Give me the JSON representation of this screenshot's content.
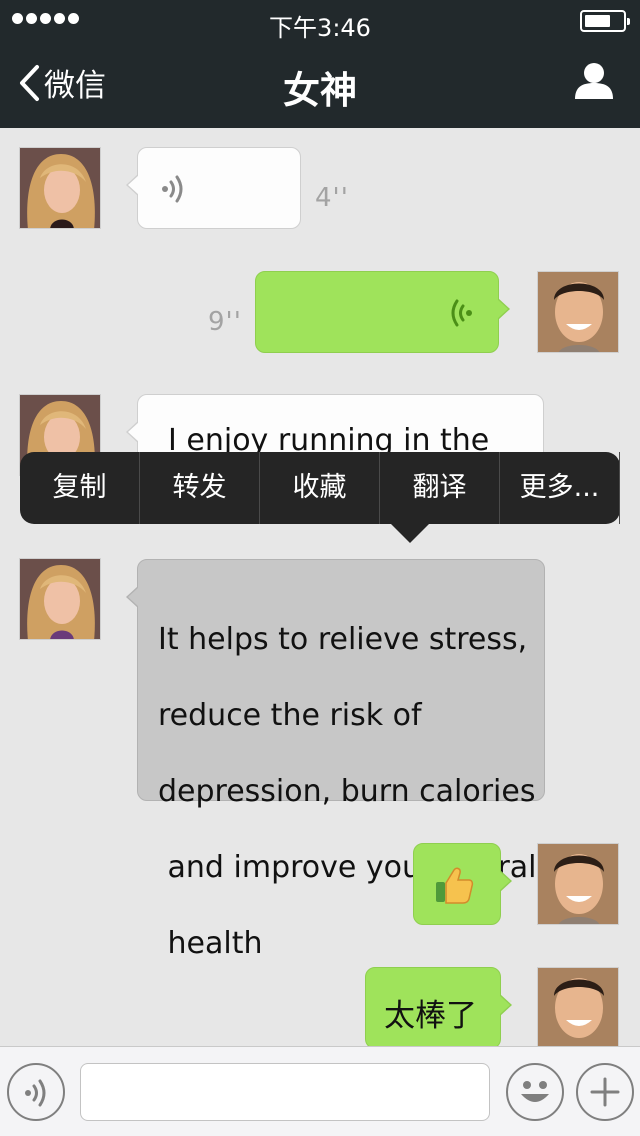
{
  "status_bar": {
    "time": "下午3:46",
    "battery_level": 0.7
  },
  "nav": {
    "back_label": "微信",
    "title": "女神"
  },
  "messages": [
    {
      "side": "in",
      "type": "voice",
      "duration": "4''"
    },
    {
      "side": "out",
      "type": "voice",
      "duration": "9''"
    },
    {
      "side": "in",
      "type": "text",
      "text": "I enjoy running in the"
    },
    {
      "side": "in",
      "type": "text",
      "selected": true,
      "lines": [
        "It helps to relieve stress,",
        "reduce the risk of",
        "depression, burn calories",
        " and improve your overall",
        " health"
      ]
    },
    {
      "side": "out",
      "type": "emoji",
      "emoji": "thumbs-up"
    },
    {
      "side": "out",
      "type": "text",
      "text": "太棒了"
    }
  ],
  "context_menu": {
    "items": [
      "复制",
      "转发",
      "收藏",
      "翻译",
      "更多..."
    ]
  },
  "colors": {
    "nav_bg": "#22292c",
    "chat_bg": "#e7e7e7",
    "out_bubble": "#9fe35b",
    "in_bubble": "#fdfdfd",
    "selected_bubble": "#c7c7c7",
    "menu_bg": "#252525"
  },
  "icons": {
    "back": "chevron-left-icon",
    "profile": "person-icon",
    "voice": "voice-wave-icon",
    "emoji": "smiley-icon",
    "plus": "plus-icon"
  }
}
